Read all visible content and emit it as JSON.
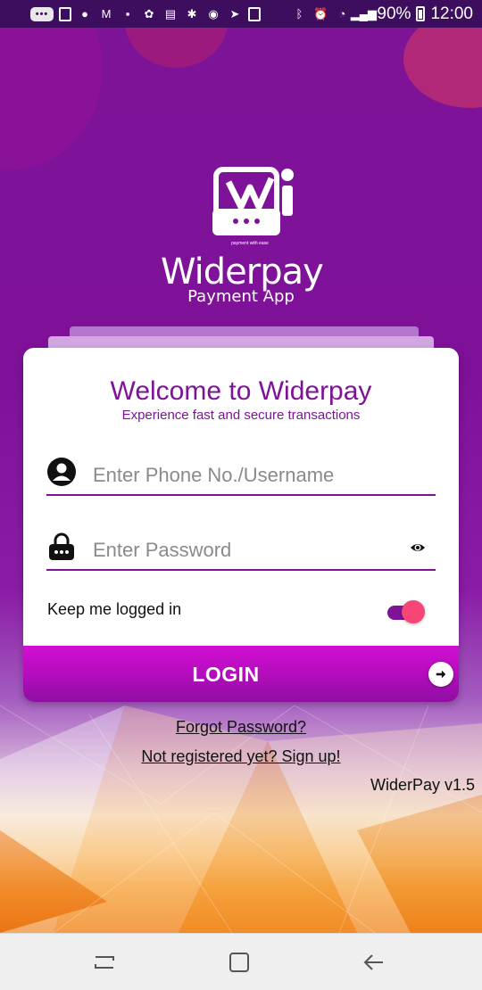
{
  "status_bar": {
    "battery": "90%",
    "time": "12:00"
  },
  "logo": {
    "brand": "Widerpay",
    "subtitle": "Payment App",
    "tagline": "payment with ease"
  },
  "card": {
    "title": "Welcome to Widerpay",
    "subtitle": "Experience fast and secure transactions",
    "phone_field": {
      "placeholder": "Enter Phone No./Username",
      "value": ""
    },
    "password_field": {
      "placeholder": "Enter Password",
      "value": ""
    },
    "keep_logged_in_label": "Keep me logged in",
    "keep_logged_in": true,
    "login_label": "LOGIN"
  },
  "links": {
    "forgot": "Forgot Password?",
    "signup": "Not registered yet? Sign up!"
  },
  "version": "WiderPay v1.5",
  "colors": {
    "primary": "#7d1397",
    "accent": "#f54677",
    "button_top": "#d20ed4",
    "button_bottom": "#8f0ea3"
  },
  "icons": {
    "user": "user-icon",
    "lock": "lock-icon",
    "eye": "eye-icon",
    "arrow": "arrow-right-icon"
  }
}
